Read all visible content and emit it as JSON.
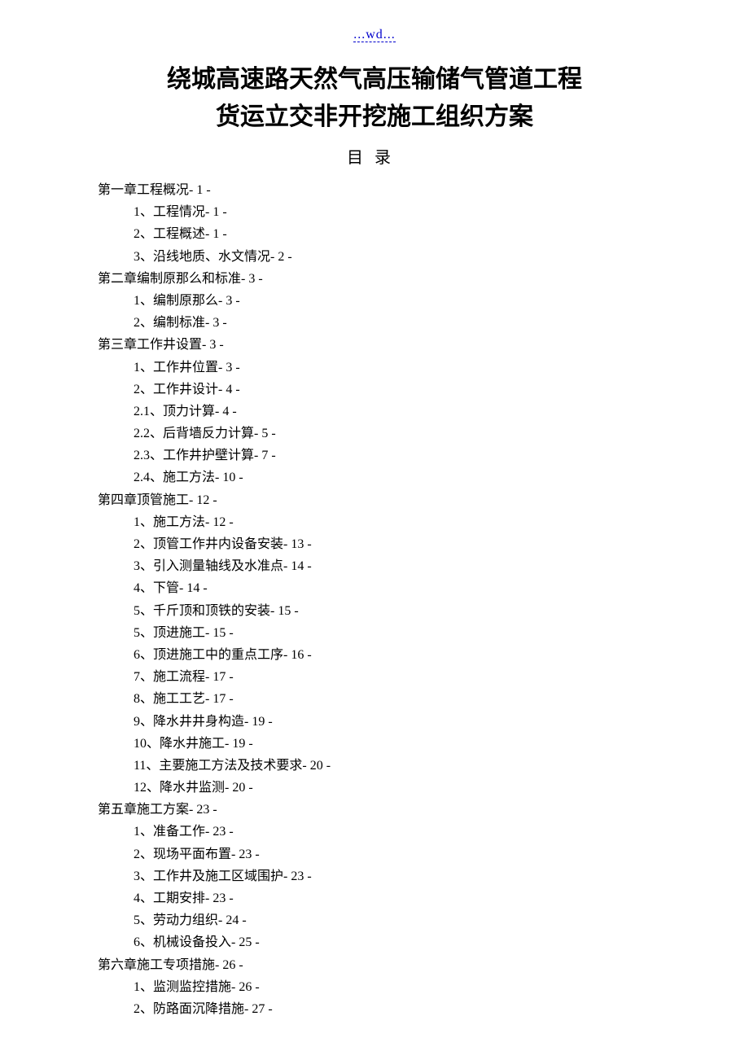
{
  "header": {
    "mark": "...wd..."
  },
  "title": "绕城高速路天然气高压输储气管道工程",
  "subtitle": "货运立交非开挖施工组织方案",
  "toc_heading": "目录",
  "toc": [
    {
      "level": "chapter",
      "text": "第一章工程概况- 1 -"
    },
    {
      "level": "item",
      "text": "1、工程情况- 1 -"
    },
    {
      "level": "item",
      "text": "2、工程概述- 1 -"
    },
    {
      "level": "item",
      "text": "3、沿线地质、水文情况- 2 -"
    },
    {
      "level": "chapter",
      "text": "第二章编制原那么和标准- 3 -"
    },
    {
      "level": "item",
      "text": "1、编制原那么- 3 -"
    },
    {
      "level": "item",
      "text": "2、编制标准- 3 -"
    },
    {
      "level": "chapter",
      "text": "第三章工作井设置- 3 -"
    },
    {
      "level": "item",
      "text": "1、工作井位置- 3 -"
    },
    {
      "level": "item",
      "text": "2、工作井设计- 4 -"
    },
    {
      "level": "item",
      "text": "2.1、顶力计算- 4 -"
    },
    {
      "level": "item",
      "text": "2.2、后背墙反力计算- 5 -"
    },
    {
      "level": "item",
      "text": "2.3、工作井护壁计算- 7 -"
    },
    {
      "level": "item",
      "text": "2.4、施工方法- 10 -"
    },
    {
      "level": "chapter",
      "text": "第四章顶管施工- 12 -"
    },
    {
      "level": "item",
      "text": "1、施工方法- 12 -"
    },
    {
      "level": "item",
      "text": "2、顶管工作井内设备安装- 13 -"
    },
    {
      "level": "item",
      "text": "3、引入测量轴线及水准点- 14 -"
    },
    {
      "level": "item",
      "text": "4、下管- 14 -"
    },
    {
      "level": "item",
      "text": "5、千斤顶和顶铁的安装- 15 -"
    },
    {
      "level": "item",
      "text": "5、顶进施工- 15 -"
    },
    {
      "level": "item",
      "text": "6、顶进施工中的重点工序- 16 -"
    },
    {
      "level": "item",
      "text": "7、施工流程- 17 -"
    },
    {
      "level": "item",
      "text": "8、施工工艺- 17 -"
    },
    {
      "level": "item",
      "text": "9、降水井井身构造- 19 -"
    },
    {
      "level": "item",
      "text": "10、降水井施工- 19 -"
    },
    {
      "level": "item",
      "text": "11、主要施工方法及技术要求- 20 -"
    },
    {
      "level": "item",
      "text": "12、降水井监测- 20 -"
    },
    {
      "level": "chapter",
      "text": "第五章施工方案- 23 -"
    },
    {
      "level": "item",
      "text": "1、准备工作- 23 -"
    },
    {
      "level": "item",
      "text": "2、现场平面布置- 23 -"
    },
    {
      "level": "item",
      "text": "3、工作井及施工区域围护- 23 -"
    },
    {
      "level": "item",
      "text": "4、工期安排- 23 -"
    },
    {
      "level": "item",
      "text": "5、劳动力组织- 24 -"
    },
    {
      "level": "item",
      "text": "6、机械设备投入- 25 -"
    },
    {
      "level": "chapter",
      "text": "第六章施工专项措施- 26 -"
    },
    {
      "level": "item",
      "text": "1、监测监控措施- 26 -"
    },
    {
      "level": "item",
      "text": "2、防路面沉降措施- 27 -"
    }
  ]
}
